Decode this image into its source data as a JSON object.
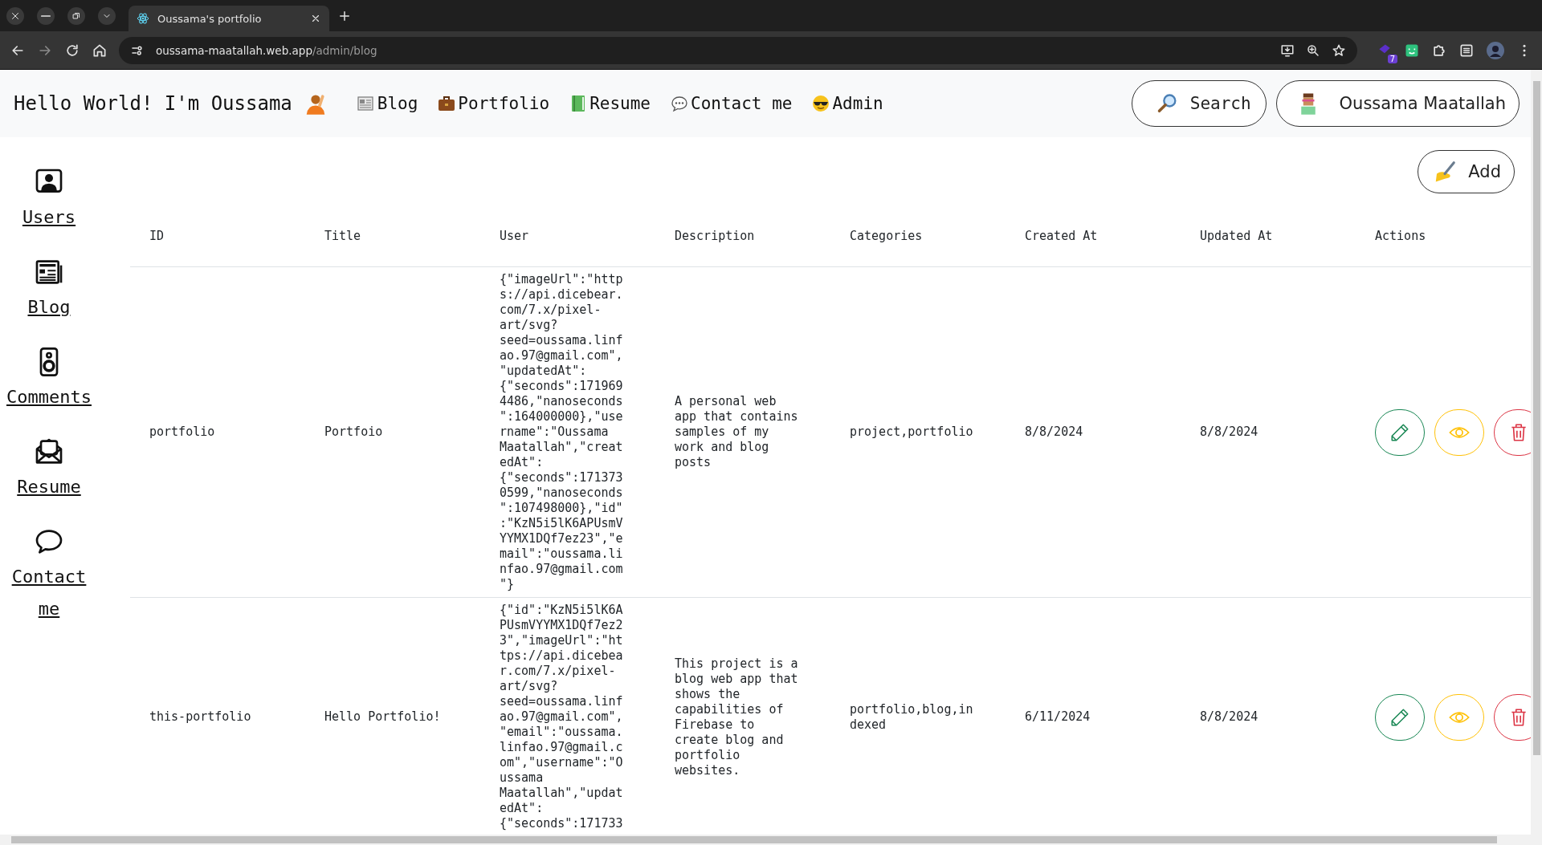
{
  "browser": {
    "tab_title": "Oussama's portfolio",
    "url_host": "oussama-maatallah.web.app",
    "url_path": "/admin/blog",
    "extension_badge": "7"
  },
  "header": {
    "greeting": "Hello World! I'm Oussama",
    "nav": [
      {
        "label": "Blog",
        "kind": "newspaper"
      },
      {
        "label": "Portfolio",
        "kind": "briefcase"
      },
      {
        "label": "Resume",
        "kind": "book"
      },
      {
        "label": "Contact me",
        "kind": "speech"
      },
      {
        "label": "Admin",
        "kind": "sunglasses"
      }
    ],
    "search_label": "Search",
    "user_name": "Oussama Maatallah"
  },
  "sidebar": {
    "items": [
      {
        "label": "Users",
        "kind": "users"
      },
      {
        "label": "Blog",
        "kind": "blog"
      },
      {
        "label": "Comments",
        "kind": "comments"
      },
      {
        "label": "Resume",
        "kind": "resume"
      },
      {
        "label": "Contact me",
        "kind": "contact"
      }
    ]
  },
  "add_button": "Add",
  "table": {
    "columns": [
      "ID",
      "Title",
      "User",
      "Description",
      "Categories",
      "Created At",
      "Updated At",
      "Actions"
    ],
    "rows": [
      {
        "id": "portfolio",
        "title": "Portfoio",
        "user": "{\"imageUrl\":\"https://api.dicebear.com/7.x/pixel-art/svg?seed=oussama.linfao.97@gmail.com\",\"updatedAt\":{\"seconds\":1719694486,\"nanoseconds\":164000000},\"username\":\"Oussama Maatallah\",\"createdAt\":{\"seconds\":1713730599,\"nanoseconds\":107498000},\"id\":\"KzN5i5lK6APUsmVYYMX1DQf7ez23\",\"email\":\"oussama.linfao.97@gmail.com\"}",
        "description": "A personal web app that contains samples of my work and blog posts",
        "categories": "project,portfolio",
        "created_at": "8/8/2024",
        "updated_at": "8/8/2024"
      },
      {
        "id": "this-portfolio",
        "title": "Hello Portfolio!",
        "user": "{\"id\":\"KzN5i5lK6APUsmVYYMX1DQf7ez23\",\"imageUrl\":\"https://api.dicebear.com/7.x/pixel-art/svg?seed=oussama.linfao.97@gmail.com\",\"email\":\"oussama.linfao.97@gmail.com\",\"username\":\"Oussama Maatallah\",\"updatedAt\":{\"seconds\":171733",
        "description": "This project is a blog web app that shows the capabilities of Firebase to create blog and portfolio websites.",
        "categories": "portfolio,blog,indexed",
        "created_at": "6/11/2024",
        "updated_at": "8/8/2024"
      }
    ]
  }
}
